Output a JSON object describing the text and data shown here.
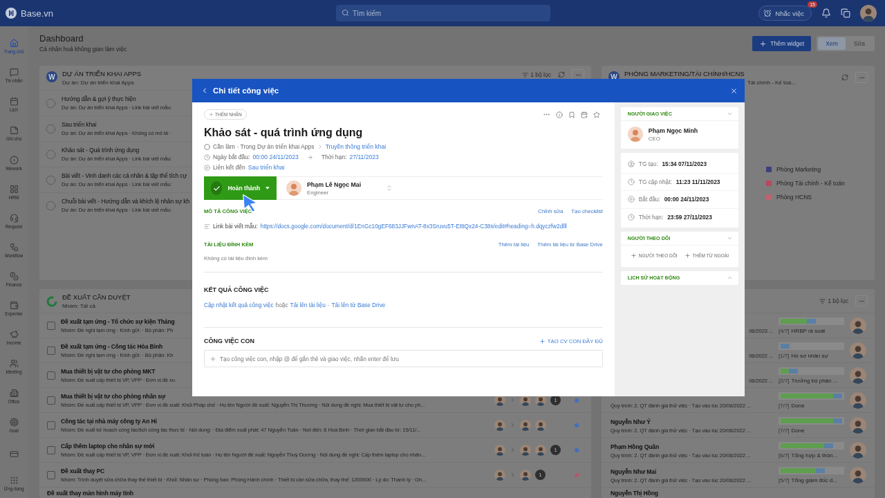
{
  "topbar": {
    "logo": "Base.vn",
    "search": {
      "placeholder": "Tìm kiếm"
    },
    "reminder": {
      "label": "Nhắc việc",
      "badge": "15"
    }
  },
  "sidebar": {
    "items": [
      {
        "label": "Trang chủ",
        "selected": true
      },
      {
        "label": "Tin nhắn",
        "selected": false
      },
      {
        "label": "Lịch",
        "selected": false
      },
      {
        "label": "Ghi chú",
        "selected": false
      },
      {
        "label": "Wework",
        "selected": false
      },
      {
        "label": "HRM",
        "selected": false
      },
      {
        "label": "Request",
        "selected": false
      },
      {
        "label": "Workflow",
        "selected": false
      },
      {
        "label": "Finance",
        "selected": false
      },
      {
        "label": "Expense",
        "selected": false
      },
      {
        "label": "Income",
        "selected": false
      },
      {
        "label": "Meeting",
        "selected": false
      },
      {
        "label": "Office",
        "selected": false
      },
      {
        "label": "Goal",
        "selected": false
      },
      {
        "selected": false
      },
      {
        "label": "Ứng dụng",
        "selected": false
      }
    ]
  },
  "dashboard": {
    "title": "Dashboard",
    "subtitle": "Cá nhân hoá không gian làm việc",
    "add_widget": "Thêm widget",
    "modes": [
      {
        "label": "Xem",
        "selected": true
      },
      {
        "label": "Sửa",
        "selected": false
      }
    ]
  },
  "projects_panel": {
    "logo_letter": "W",
    "title": "DỰ ÁN TRIỂN KHAI APPS",
    "subtitle": "Dự án: Dự án triển khai Apps",
    "filter": "1 bộ lọc",
    "tasks": [
      {
        "title": "Hướng dẫn & gợi ý thực hiện",
        "meta": "Dự án: Dự án triển khai Apps · Link bài viết mẫu:"
      },
      {
        "title": "Sau triển khai",
        "meta": "Dự án: Dự án triển khai Apps · Không có mô tả ·"
      },
      {
        "title": "Khảo sát - Quá trình ứng dụng",
        "meta": "Dự án: Dự án triển khai Apps · Link bài viết mẫu:"
      },
      {
        "title": "Bài viết - Vinh danh các cá nhân & tập thể tích cự",
        "meta": "Dự án: Dự án triển khai Apps · Link bài viết mẫu:"
      },
      {
        "title": "Chuỗi bài viết - Hướng dẫn và khích lệ nhân sự kh",
        "meta": "Dự án: Dự án triển khai Apps · Link bài viết mẫu:"
      }
    ]
  },
  "department_panel": {
    "logo_letter": "W",
    "title": "PHÒNG MARKETING/TÀI CHÍNH/HCNS",
    "subtitle": "Tài chính - Kế toá...",
    "legend": [
      {
        "label": "Phòng Marketing",
        "color": "#3c3f7c"
      },
      {
        "label": "Phòng Tài chính - Kế toán",
        "color": "#b9485f"
      },
      {
        "label": "Phòng HCNS",
        "color": "#c0636e"
      }
    ]
  },
  "requests_panel": {
    "title": "ĐỀ XUẤT CẦN DUYỆT",
    "subtitle": "Nhóm: Tất cả",
    "rows": [
      {
        "checked": false,
        "title": "Đề xuất tạm ứng - Tổ chức sự kiện Tháng",
        "meta": "Nhóm: Đề nghị tạm ứng · Kính gửi: · Bộ phận: Ph"
      },
      {
        "checked": false,
        "title": "Đề xuất tạm ứng - Công tác Hòa Bình",
        "meta": "Nhóm: Đề nghị tạm ứng · Kính gửi: · Bộ phận: Kh"
      },
      {
        "checked": false,
        "title": "Mua thiết bị vật tư cho phòng MKT",
        "meta": "Nhóm: Đề xuất cấp thiết bị VP, VPP · Đơn vị đề xu"
      },
      {
        "checked": false,
        "title": "Mua thiết bị vật tư cho phòng nhân sự",
        "meta": "Nhóm: Đề xuất cấp thiết bị VP, VPP · Đơn vị đề xuất: Khối Pháp chế · Họ tên Người đề xuất: Nguyễn Thị Thương · Nội dung đề nghị: Mua thiết bị vật tư cho ph...",
        "approvers": [
          {
            "kind": "avatar"
          },
          {
            "kind": "avatar"
          }
        ],
        "count": "1",
        "color": "#3f6fc0"
      },
      {
        "checked": false,
        "title": "Công tác tại nhà máy công ty An Hi",
        "meta": "Nhóm: Đề xuất kế hoạch công tác/lịch công tác thực tế · Nội dung: · Địa điểm xuất phát: 47 Nguyễn Tuân · Nơi đến: 6 Hoà Bình · Thời gian bắt đầu từ: 15/11/...",
        "approvers": [
          {
            "kind": "avatar"
          },
          {
            "kind": "avatar"
          }
        ],
        "color": "#3f6fc0"
      },
      {
        "checked": false,
        "title": "Cấp thêm laptop cho nhân sự mới",
        "meta": "Nhóm: Đề xuất cấp thiết bị VP, VPP · Đơn vị đề xuất: Khối Kế toán · Họ tên Người đề xuất: Nguyễn Thuỳ Dương · Nội dung đề nghị: Cấp thêm laptop cho nhân...",
        "approvers": [
          {
            "kind": "avatar"
          },
          {
            "kind": "avatar"
          }
        ],
        "count": "1",
        "color": "#3f6fc0"
      },
      {
        "checked": false,
        "title": "Đề xuất thay PC",
        "meta": "Nhóm: Trình duyệt sửa chữa thay thế thiết bị · Khối: Nhân sự · Phòng ban: Phòng Hành chính · Thiết bị cần sửa chữa, thay thế: 1200000 · Lý do: Thanh lý · Gh...",
        "approvers": [
          {
            "kind": "avatar"
          }
        ],
        "count": "1",
        "color": "#b9576a"
      },
      {
        "title": "Đề xuất thay màn hình máy tính"
      }
    ]
  },
  "onboarding_panel": {
    "filter": "1 bộ lọc",
    "rows": [
      {
        "kind": "partial",
        "meta": "06/2023 ...",
        "level": 0.571,
        "step": "[4/7]",
        "step_label": "HRBP rà soát"
      },
      {
        "kind": "partial",
        "meta": "06/2022 ...",
        "level": 0.143,
        "step": "[1/7]",
        "step_label": "Hồ sơ nhân sự"
      },
      {
        "kind": "partial",
        "meta": "06/2022 ...",
        "level": 0.286,
        "step": "[2/7]",
        "step_label": "Trưởng bộ phận ..."
      },
      {
        "kind": "full",
        "meta": "Quy trình: 2. QT đánh giá thử việc · Tạo vào lúc 20/06/2022 ...",
        "level": 1,
        "step": "[7/7]",
        "step_label": "Done"
      },
      {
        "kind": "full",
        "name": "Nguyễn Như Ý",
        "meta": "Quy trình: 2. QT đánh giá thử việc · Tạo vào lúc 20/06/2022 ...",
        "level": 1,
        "step": "[7/7]",
        "step_label": "Done"
      },
      {
        "kind": "full",
        "name": "Phạm Hồng Quân",
        "meta": "Quy trình: 2. QT đánh giá thử việc · Tạo vào lúc 20/06/2022 ...",
        "level": 0.857,
        "step": "[6/7]",
        "step_label": "Tổng hợp & thôn..."
      },
      {
        "kind": "full",
        "name": "Nguyễn Như Mai",
        "meta": "Quy trình: 2. QT đánh giá thử việc · Tạo vào lúc 20/06/2022 ...",
        "level": 0.714,
        "step": "[5/7]",
        "step_label": "Tổng giám đốc d..."
      },
      {
        "kind": "full",
        "name": "Nguyễn Thị Hồng"
      }
    ]
  },
  "task_modal": {
    "title": "Chi tiết công việc",
    "add_label": "THÊM NHÃN",
    "task_title": "Khảo sát - quá trình ứng dụng",
    "status_line": {
      "text": "Cần làm · Trong Dự án triển khai Apps",
      "link": "Truyền thông triển khai"
    },
    "dates": {
      "start_label": "Ngày bắt đầu:",
      "start": "00:00 24/11/2023",
      "due_label": "Thời hạn:",
      "due": "27/11/2023"
    },
    "linked": {
      "label": "Liên kết đến",
      "link": "Sau triển khai"
    },
    "status_button": {
      "label": "Hoàn thành"
    },
    "assignee": {
      "name": "Phạm Lê Ngọc Mai",
      "role": "Engineer"
    },
    "description": {
      "heading": "MÔ TẢ CÔNG VIỆC",
      "actions": [
        "Chỉnh sửa",
        "Tạo checklist"
      ],
      "label": "Link bài viết mẫu:",
      "url": "https://docs.google.com/document/d/1EnGc10gEF683JJFwnAT-8x3Sruvu5T-E8tQx24-C38s/edit#heading=h.dqyczfw2dlll"
    },
    "attachments": {
      "heading": "TÀI LIỆU ĐÍNH KÈM",
      "actions": [
        "Thêm tài liệu",
        "Thêm tài liệu từ Base Drive"
      ],
      "empty": "Không có tài liệu đính kèm"
    },
    "result": {
      "heading": "KẾT QUẢ CÔNG VIỆC",
      "update_link": "Cập nhật kết quả công việc",
      "or": "hoặc",
      "upload_link": "Tải lên tài liệu",
      "separator": "·",
      "drive_link": "Tải lên từ Base Drive"
    },
    "subtasks": {
      "heading": "CÔNG VIỆC CON",
      "create_full": "TẠO CV CON ĐẦY ĐỦ",
      "input": {
        "placeholder": "Tạo công việc con, nhập @ để gắn thẻ và giao việc, nhấn enter để lưu"
      }
    },
    "assigner": {
      "heading": "NGƯỜI GIAO VIỆC",
      "expanded": true,
      "name": "Phạm Ngọc Minh",
      "role": "CEO"
    },
    "times": [
      {
        "label": "TG tạo:",
        "value": "15:34 07/11/2023"
      },
      {
        "label": "TG cập nhật:",
        "value": "11:23 11/11/2023"
      },
      {
        "label": "Bắt đầu:",
        "value": "00:00 24/11/2023"
      },
      {
        "label": "Thời hạn:",
        "value": "23:59 27/11/2023"
      }
    ],
    "followers": {
      "heading": "NGƯỜI THEO DÕI",
      "expanded": true,
      "actions": [
        "NGƯỜI THEO DÕI",
        "THÊM TỪ NGOÀI"
      ]
    },
    "history": {
      "heading": "LỊCH SỬ HOẠT ĐỘNG",
      "expanded": false
    }
  }
}
